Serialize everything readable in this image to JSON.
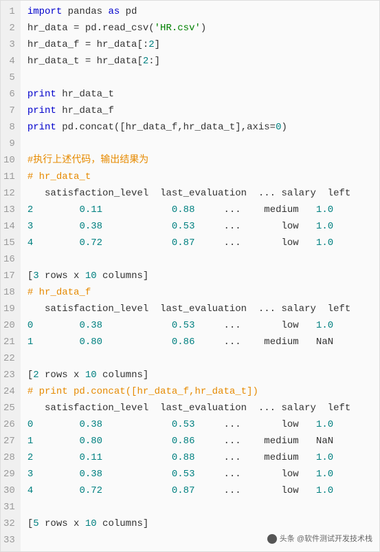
{
  "lines": [
    {
      "n": "1",
      "segs": [
        {
          "t": "import ",
          "c": "kw"
        },
        {
          "t": "pandas "
        },
        {
          "t": "as ",
          "c": "kw"
        },
        {
          "t": "pd"
        }
      ]
    },
    {
      "n": "2",
      "segs": [
        {
          "t": "hr_data = pd.read_csv("
        },
        {
          "t": "'HR.csv'",
          "c": "str"
        },
        {
          "t": ")"
        }
      ]
    },
    {
      "n": "3",
      "segs": [
        {
          "t": "hr_data_f = hr_data[:"
        },
        {
          "t": "2",
          "c": "num"
        },
        {
          "t": "]"
        }
      ]
    },
    {
      "n": "4",
      "segs": [
        {
          "t": "hr_data_t = hr_data["
        },
        {
          "t": "2",
          "c": "num"
        },
        {
          "t": ":]"
        }
      ]
    },
    {
      "n": "5",
      "segs": [
        {
          "t": ""
        }
      ]
    },
    {
      "n": "6",
      "segs": [
        {
          "t": "print ",
          "c": "kw"
        },
        {
          "t": "hr_data_t"
        }
      ]
    },
    {
      "n": "7",
      "segs": [
        {
          "t": "print ",
          "c": "kw"
        },
        {
          "t": "hr_data_f"
        }
      ]
    },
    {
      "n": "8",
      "segs": [
        {
          "t": "print ",
          "c": "kw"
        },
        {
          "t": "pd.concat([hr_data_f,hr_data_t],axis="
        },
        {
          "t": "0",
          "c": "num"
        },
        {
          "t": ")"
        }
      ]
    },
    {
      "n": "9",
      "segs": [
        {
          "t": ""
        }
      ]
    },
    {
      "n": "10",
      "segs": [
        {
          "t": "#执行上述代码，输出结果为",
          "c": "cmt-orange"
        }
      ]
    },
    {
      "n": "11",
      "segs": [
        {
          "t": "# hr_data_t",
          "c": "cmt-orange"
        }
      ]
    },
    {
      "n": "12",
      "segs": [
        {
          "t": "   satisfaction_level  last_evaluation  ... salary  left"
        }
      ]
    },
    {
      "n": "13",
      "segs": [
        {
          "t": "2",
          "c": "num"
        },
        {
          "t": "        "
        },
        {
          "t": "0.11",
          "c": "num"
        },
        {
          "t": "            "
        },
        {
          "t": "0.88",
          "c": "num"
        },
        {
          "t": "     ...    medium   "
        },
        {
          "t": "1.0",
          "c": "num"
        }
      ]
    },
    {
      "n": "14",
      "segs": [
        {
          "t": "3",
          "c": "num"
        },
        {
          "t": "        "
        },
        {
          "t": "0.38",
          "c": "num"
        },
        {
          "t": "            "
        },
        {
          "t": "0.53",
          "c": "num"
        },
        {
          "t": "     ...       low   "
        },
        {
          "t": "1.0",
          "c": "num"
        }
      ]
    },
    {
      "n": "15",
      "segs": [
        {
          "t": "4",
          "c": "num"
        },
        {
          "t": "        "
        },
        {
          "t": "0.72",
          "c": "num"
        },
        {
          "t": "            "
        },
        {
          "t": "0.87",
          "c": "num"
        },
        {
          "t": "     ...       low   "
        },
        {
          "t": "1.0",
          "c": "num"
        }
      ]
    },
    {
      "n": "16",
      "segs": [
        {
          "t": ""
        }
      ]
    },
    {
      "n": "17",
      "segs": [
        {
          "t": "["
        },
        {
          "t": "3",
          "c": "num"
        },
        {
          "t": " rows x "
        },
        {
          "t": "10",
          "c": "num"
        },
        {
          "t": " columns]"
        }
      ]
    },
    {
      "n": "18",
      "segs": [
        {
          "t": "# hr_data_f",
          "c": "cmt-orange"
        }
      ]
    },
    {
      "n": "19",
      "segs": [
        {
          "t": "   satisfaction_level  last_evaluation  ... salary  left"
        }
      ]
    },
    {
      "n": "20",
      "segs": [
        {
          "t": "0",
          "c": "num"
        },
        {
          "t": "        "
        },
        {
          "t": "0.38",
          "c": "num"
        },
        {
          "t": "            "
        },
        {
          "t": "0.53",
          "c": "num"
        },
        {
          "t": "     ...       low   "
        },
        {
          "t": "1.0",
          "c": "num"
        }
      ]
    },
    {
      "n": "21",
      "segs": [
        {
          "t": "1",
          "c": "num"
        },
        {
          "t": "        "
        },
        {
          "t": "0.80",
          "c": "num"
        },
        {
          "t": "            "
        },
        {
          "t": "0.86",
          "c": "num"
        },
        {
          "t": "     ...    medium   NaN"
        }
      ]
    },
    {
      "n": "22",
      "segs": [
        {
          "t": ""
        }
      ]
    },
    {
      "n": "23",
      "segs": [
        {
          "t": "["
        },
        {
          "t": "2",
          "c": "num"
        },
        {
          "t": " rows x "
        },
        {
          "t": "10",
          "c": "num"
        },
        {
          "t": " columns]"
        }
      ]
    },
    {
      "n": "24",
      "segs": [
        {
          "t": "# print pd.concat([hr_data_f,hr_data_t])",
          "c": "cmt-orange"
        }
      ]
    },
    {
      "n": "25",
      "segs": [
        {
          "t": "   satisfaction_level  last_evaluation  ... salary  left"
        }
      ]
    },
    {
      "n": "26",
      "segs": [
        {
          "t": "0",
          "c": "num"
        },
        {
          "t": "        "
        },
        {
          "t": "0.38",
          "c": "num"
        },
        {
          "t": "            "
        },
        {
          "t": "0.53",
          "c": "num"
        },
        {
          "t": "     ...       low   "
        },
        {
          "t": "1.0",
          "c": "num"
        }
      ]
    },
    {
      "n": "27",
      "segs": [
        {
          "t": "1",
          "c": "num"
        },
        {
          "t": "        "
        },
        {
          "t": "0.80",
          "c": "num"
        },
        {
          "t": "            "
        },
        {
          "t": "0.86",
          "c": "num"
        },
        {
          "t": "     ...    medium   NaN"
        }
      ]
    },
    {
      "n": "28",
      "segs": [
        {
          "t": "2",
          "c": "num"
        },
        {
          "t": "        "
        },
        {
          "t": "0.11",
          "c": "num"
        },
        {
          "t": "            "
        },
        {
          "t": "0.88",
          "c": "num"
        },
        {
          "t": "     ...    medium   "
        },
        {
          "t": "1.0",
          "c": "num"
        }
      ]
    },
    {
      "n": "29",
      "segs": [
        {
          "t": "3",
          "c": "num"
        },
        {
          "t": "        "
        },
        {
          "t": "0.38",
          "c": "num"
        },
        {
          "t": "            "
        },
        {
          "t": "0.53",
          "c": "num"
        },
        {
          "t": "     ...       low   "
        },
        {
          "t": "1.0",
          "c": "num"
        }
      ]
    },
    {
      "n": "30",
      "segs": [
        {
          "t": "4",
          "c": "num"
        },
        {
          "t": "        "
        },
        {
          "t": "0.72",
          "c": "num"
        },
        {
          "t": "            "
        },
        {
          "t": "0.87",
          "c": "num"
        },
        {
          "t": "     ...       low   "
        },
        {
          "t": "1.0",
          "c": "num"
        }
      ]
    },
    {
      "n": "31",
      "segs": [
        {
          "t": ""
        }
      ]
    },
    {
      "n": "32",
      "segs": [
        {
          "t": "["
        },
        {
          "t": "5",
          "c": "num"
        },
        {
          "t": " rows x "
        },
        {
          "t": "10",
          "c": "num"
        },
        {
          "t": " columns]"
        }
      ]
    },
    {
      "n": "33",
      "segs": [
        {
          "t": ""
        }
      ]
    }
  ],
  "watermark": "头条 @软件测试开发技术栈"
}
